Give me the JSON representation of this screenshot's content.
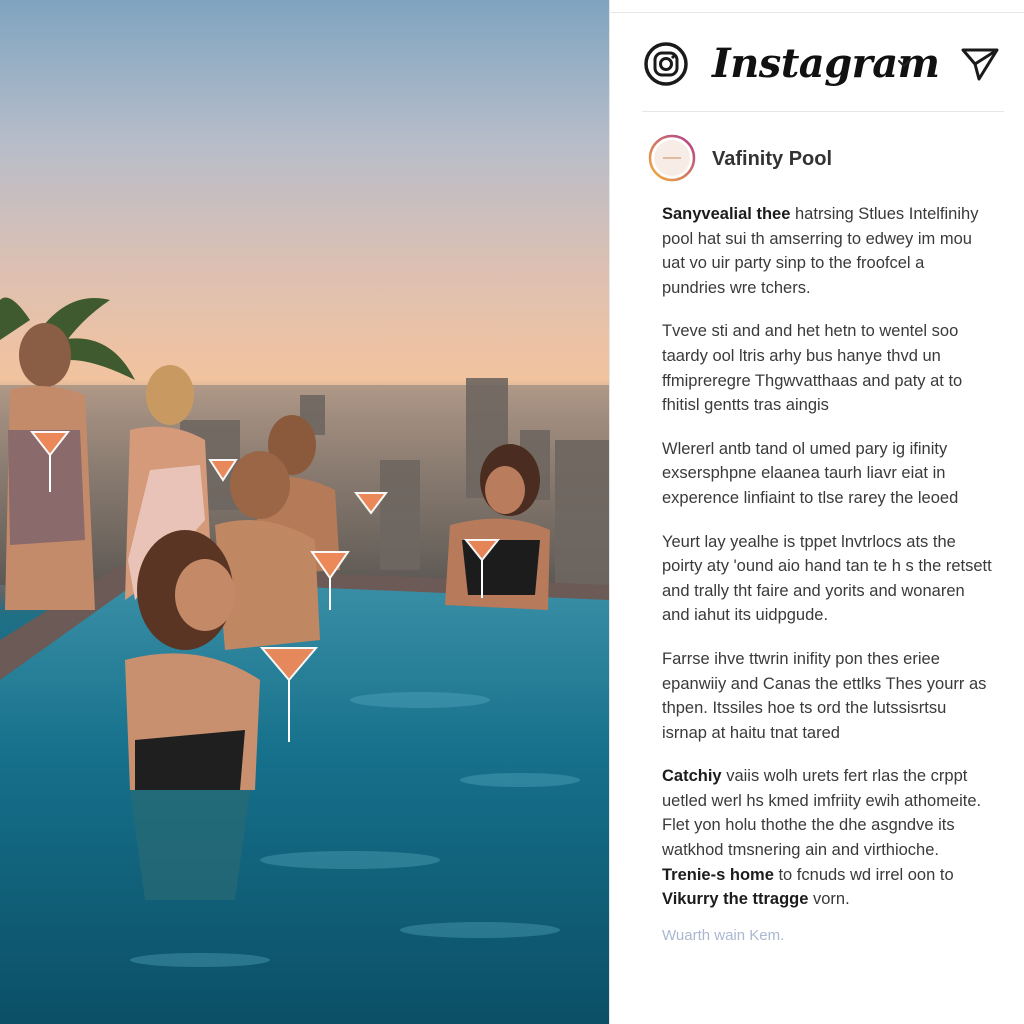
{
  "app": {
    "name": "Instagram"
  },
  "post": {
    "account_name": "Vafinity Pool",
    "caption": {
      "p1_lead": "Sanyvealial thee",
      "p1_rest": " hatrsing Stlues Intelfinihy pool hat sui th amserring to edwey im mou uat vo uir party sinp to the froofcel a pundries wre tchers.",
      "p2": "Tveve sti and and het hetn to wentel soo taardy ool ltris arhy bus hanye thvd un ffmipreregre Thgwvatthaas and paty at to fhitisl gentts tras aingis",
      "p3": "Wlererl antb tand ol umed pary ig ifinity exsersphpne elaanea taurh liavr eiat in experence linfiaint to tlse rarey the leoed",
      "p4": "Yeurt lay yealhe is tppet lnvtrlocs ats the poirty aty 'ound aio hand tan te h s the retsett and trally tht faire and yorits and wonaren and iahut its uidpgude.",
      "p5": "Farrse ihve ttwrin inifity pon thes eriee epanwiiy and Canas the ettlks Thes yourr as thpen. Itssiles hoe ts ord the lutssisrtsu isrnap at haitu tnat tared",
      "p6_lead": "Catchiy",
      "p6_rest": " vaiis wolh urets fert rlas the crppt uetled werl hs kmed imfriity ewih athomeite. Flet yon holu thothe the dhe asgndve its watkhod tmsnering ain and virthioche.",
      "p7_lead": "Trenie-s home",
      "p7_rest": " to fcnuds wd irrel oon to",
      "p8_lead": "Vikurry the ttragge",
      "p8_rest": " vorn.",
      "faded": "Wuarth wain Kem."
    }
  },
  "colors": {
    "avatar_ring_start": "#f2b33d",
    "avatar_ring_end": "#b03a8e",
    "text": "#3a3a3a",
    "faded_text": "#a9b7d0"
  },
  "icons": {
    "logo": "instagram-camera-icon",
    "dropdown": "chevron-down-icon",
    "direct": "paper-plane-send-icon"
  }
}
